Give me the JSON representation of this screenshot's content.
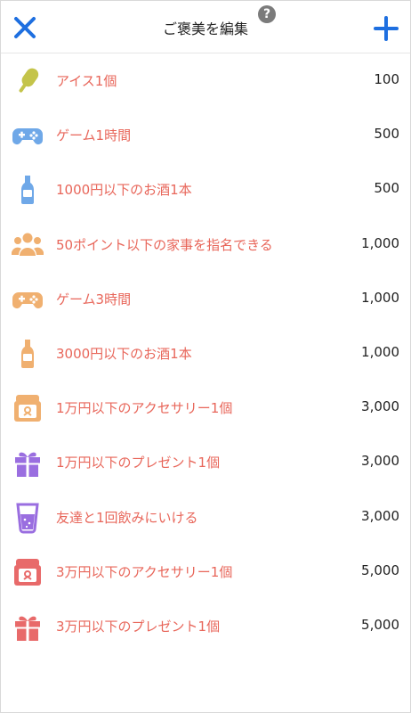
{
  "header": {
    "title": "ご褒美を編集",
    "help_label": "?"
  },
  "colors": {
    "accent": "#1e6fe0",
    "label": "#e8665a",
    "help": "#7b7b7b"
  },
  "rewards": [
    {
      "label": "アイス1個",
      "points": "100",
      "icon": "ice-pop-icon",
      "icon_color": "#c4c44a"
    },
    {
      "label": "ゲーム1時間",
      "points": "500",
      "icon": "gamepad-icon",
      "icon_color": "#6fa8e8"
    },
    {
      "label": "1000円以下のお酒1本",
      "points": "500",
      "icon": "bottle-icon",
      "icon_color": "#6fa8e8"
    },
    {
      "label": "50ポイント以下の家事を指名できる",
      "points": "1,000",
      "icon": "people-icon",
      "icon_color": "#f0b070"
    },
    {
      "label": "ゲーム3時間",
      "points": "1,000",
      "icon": "gamepad-icon",
      "icon_color": "#f0b070"
    },
    {
      "label": "3000円以下のお酒1本",
      "points": "1,000",
      "icon": "bottle-icon",
      "icon_color": "#f0b070"
    },
    {
      "label": "1万円以下のアクセサリー1個",
      "points": "3,000",
      "icon": "jewelry-box-icon",
      "icon_color": "#f0b070"
    },
    {
      "label": "1万円以下のプレゼント1個",
      "points": "3,000",
      "icon": "gift-icon",
      "icon_color": "#9a6ee0"
    },
    {
      "label": "友達と1回飲みにいける",
      "points": "3,000",
      "icon": "drink-glass-icon",
      "icon_color": "#9a6ee0"
    },
    {
      "label": "3万円以下のアクセサリー1個",
      "points": "5,000",
      "icon": "jewelry-box-icon",
      "icon_color": "#e86a6a"
    },
    {
      "label": "3万円以下のプレゼント1個",
      "points": "5,000",
      "icon": "gift-icon",
      "icon_color": "#e86a6a"
    }
  ]
}
